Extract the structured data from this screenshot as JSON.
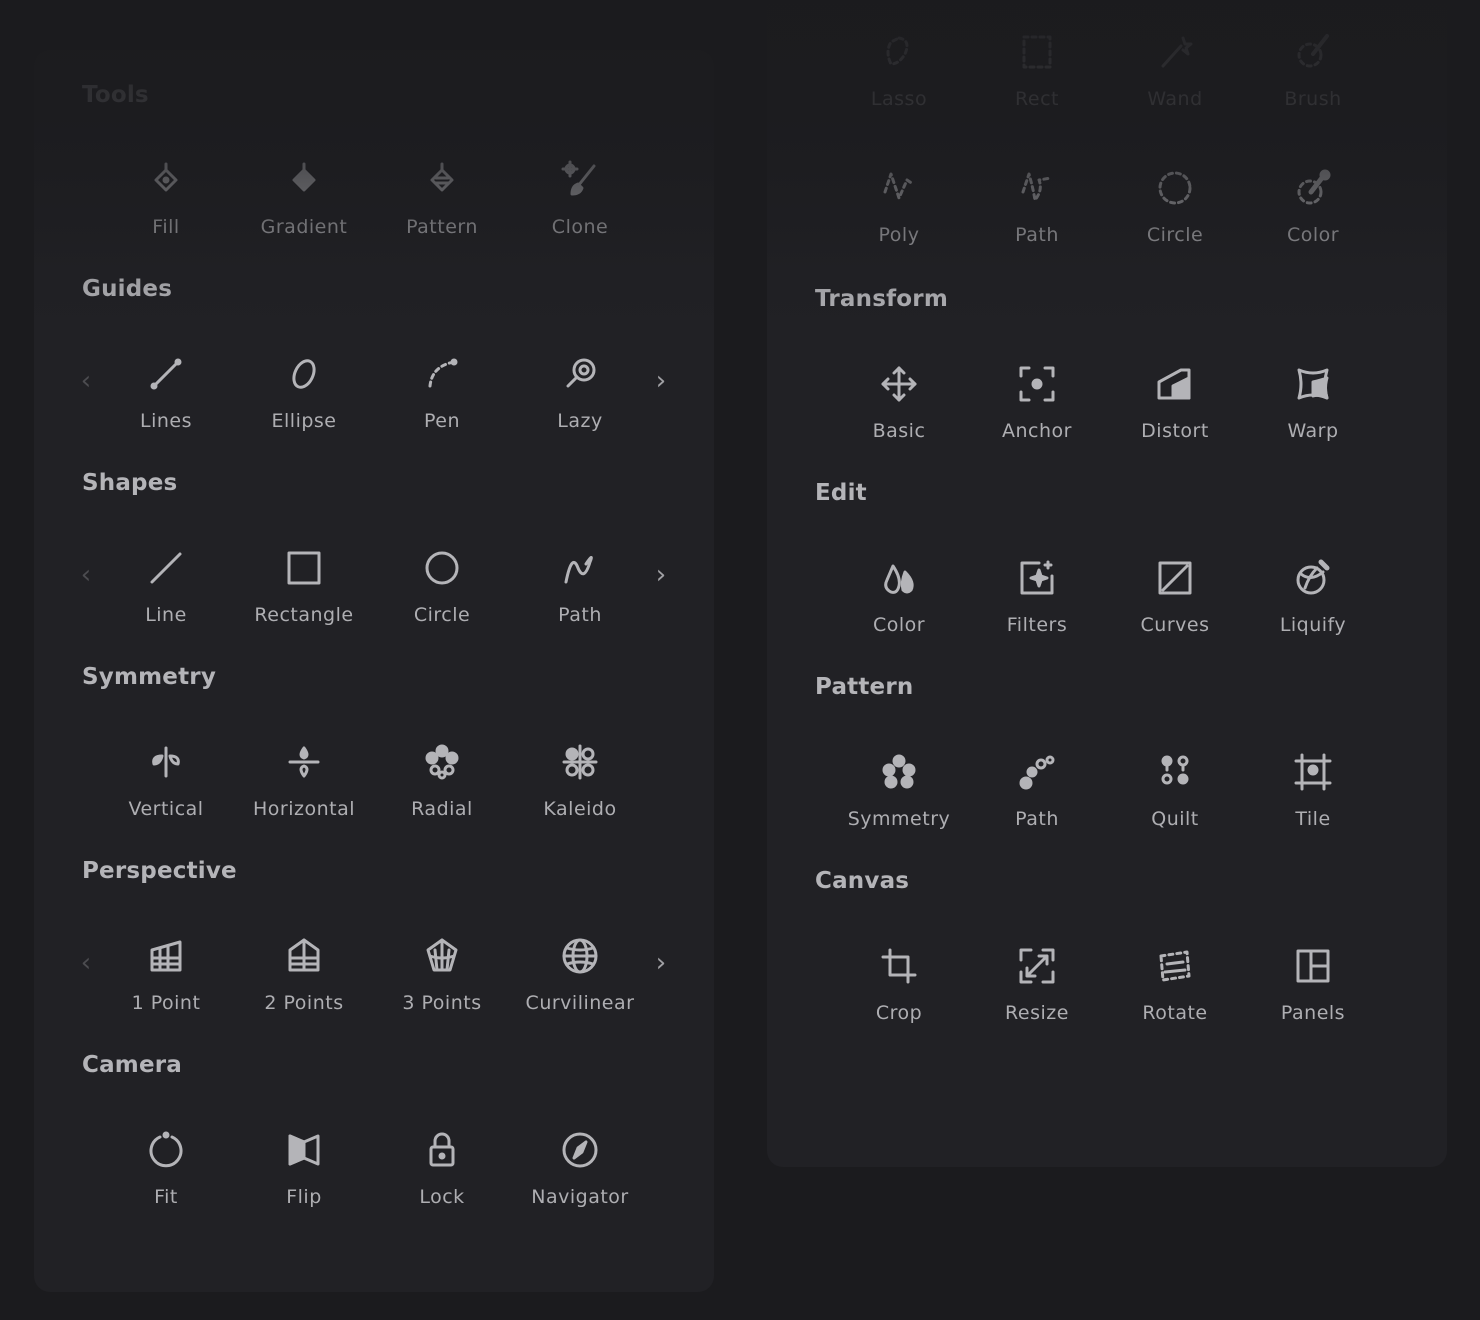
{
  "colors": {
    "background": "#1b1b1e",
    "panel": "#212125",
    "text": "#b2b2b6",
    "icon": "#b4b4b8"
  },
  "left_panel": {
    "sections": [
      {
        "title": "Tools",
        "arrows": false,
        "items": [
          {
            "label": "Fill",
            "icon": "fill-bucket-icon"
          },
          {
            "label": "Gradient",
            "icon": "gradient-fill-icon"
          },
          {
            "label": "Pattern",
            "icon": "pattern-fill-icon"
          },
          {
            "label": "Clone",
            "icon": "clone-brush-icon"
          }
        ]
      },
      {
        "title": "Guides",
        "arrows": true,
        "items": [
          {
            "label": "Lines",
            "icon": "line-guide-icon"
          },
          {
            "label": "Ellipse",
            "icon": "ellipse-guide-icon"
          },
          {
            "label": "Pen",
            "icon": "pen-curve-icon"
          },
          {
            "label": "Lazy",
            "icon": "lazy-brush-icon"
          }
        ]
      },
      {
        "title": "Shapes",
        "arrows": true,
        "items": [
          {
            "label": "Line",
            "icon": "line-icon"
          },
          {
            "label": "Rectangle",
            "icon": "rectangle-icon"
          },
          {
            "label": "Circle",
            "icon": "circle-icon"
          },
          {
            "label": "Path",
            "icon": "path-icon"
          }
        ]
      },
      {
        "title": "Symmetry",
        "arrows": false,
        "items": [
          {
            "label": "Vertical",
            "icon": "vertical-symmetry-icon"
          },
          {
            "label": "Horizontal",
            "icon": "horizontal-symmetry-icon"
          },
          {
            "label": "Radial",
            "icon": "radial-symmetry-icon"
          },
          {
            "label": "Kaleido",
            "icon": "kaleido-symmetry-icon"
          }
        ]
      },
      {
        "title": "Perspective",
        "arrows": true,
        "items": [
          {
            "label": "1 Point",
            "icon": "one-point-perspective-icon"
          },
          {
            "label": "2 Points",
            "icon": "two-point-perspective-icon"
          },
          {
            "label": "3 Points",
            "icon": "three-point-perspective-icon"
          },
          {
            "label": "Curvilinear",
            "icon": "globe-icon"
          }
        ]
      },
      {
        "title": "Camera",
        "arrows": false,
        "items": [
          {
            "label": "Fit",
            "icon": "fit-icon"
          },
          {
            "label": "Flip",
            "icon": "flip-icon"
          },
          {
            "label": "Lock",
            "icon": "lock-icon"
          },
          {
            "label": "Navigator",
            "icon": "compass-icon"
          }
        ]
      }
    ],
    "prev_glyph": "‹",
    "next_glyph": "›"
  },
  "right_panel": {
    "sections": [
      {
        "title": "",
        "items": [
          {
            "label": "Lasso",
            "icon": "lasso-select-icon"
          },
          {
            "label": "Rect",
            "icon": "rect-select-icon"
          },
          {
            "label": "Wand",
            "icon": "magic-wand-icon"
          },
          {
            "label": "Brush",
            "icon": "brush-select-icon"
          },
          {
            "label": "Poly",
            "icon": "poly-select-icon"
          },
          {
            "label": "Path",
            "icon": "path-select-icon"
          },
          {
            "label": "Circle",
            "icon": "circle-select-icon"
          },
          {
            "label": "Color",
            "icon": "color-select-icon"
          }
        ]
      },
      {
        "title": "Transform",
        "items": [
          {
            "label": "Basic",
            "icon": "move-icon"
          },
          {
            "label": "Anchor",
            "icon": "anchor-icon"
          },
          {
            "label": "Distort",
            "icon": "distort-icon"
          },
          {
            "label": "Warp",
            "icon": "warp-icon"
          }
        ]
      },
      {
        "title": "Edit",
        "items": [
          {
            "label": "Color",
            "icon": "color-drops-icon"
          },
          {
            "label": "Filters",
            "icon": "filters-icon"
          },
          {
            "label": "Curves",
            "icon": "curves-icon"
          },
          {
            "label": "Liquify",
            "icon": "liquify-icon"
          }
        ]
      },
      {
        "title": "Pattern",
        "items": [
          {
            "label": "Symmetry",
            "icon": "pattern-symmetry-icon"
          },
          {
            "label": "Path",
            "icon": "pattern-path-icon"
          },
          {
            "label": "Quilt",
            "icon": "quilt-icon"
          },
          {
            "label": "Tile",
            "icon": "tile-icon"
          }
        ]
      },
      {
        "title": "Canvas",
        "items": [
          {
            "label": "Crop",
            "icon": "crop-icon"
          },
          {
            "label": "Resize",
            "icon": "resize-icon"
          },
          {
            "label": "Rotate",
            "icon": "rotate-icon"
          },
          {
            "label": "Panels",
            "icon": "panels-icon"
          }
        ]
      }
    ]
  }
}
